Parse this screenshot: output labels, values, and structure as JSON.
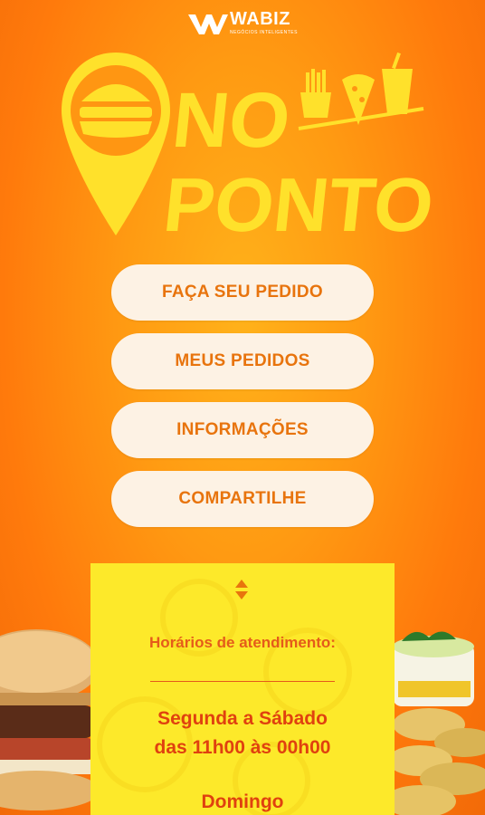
{
  "brand": {
    "name": "WABIZ",
    "tagline": "NEGÓCIOS INTELIGENTES"
  },
  "logo": {
    "line1": "NO",
    "line2": "PONTO"
  },
  "menu": {
    "items": [
      {
        "label": "FAÇA SEU PEDIDO"
      },
      {
        "label": "MEUS PEDIDOS"
      },
      {
        "label": "INFORMAÇÕES"
      },
      {
        "label": "COMPARTILHE"
      }
    ]
  },
  "hours": {
    "title": "Horários de atendimento:",
    "days": "Segunda a Sábado",
    "time": "das 11h00 às 00h00",
    "next_day": "Domingo"
  },
  "colors": {
    "accent": "#e8740d",
    "panel": "#fde92a",
    "text_red": "#e0410f",
    "logo_yellow": "#ffe12b"
  },
  "icons": [
    "wabiz-logo-icon",
    "burger-pin-icon",
    "fries-icon",
    "pizza-icon",
    "drink-icon",
    "sort-icon"
  ]
}
